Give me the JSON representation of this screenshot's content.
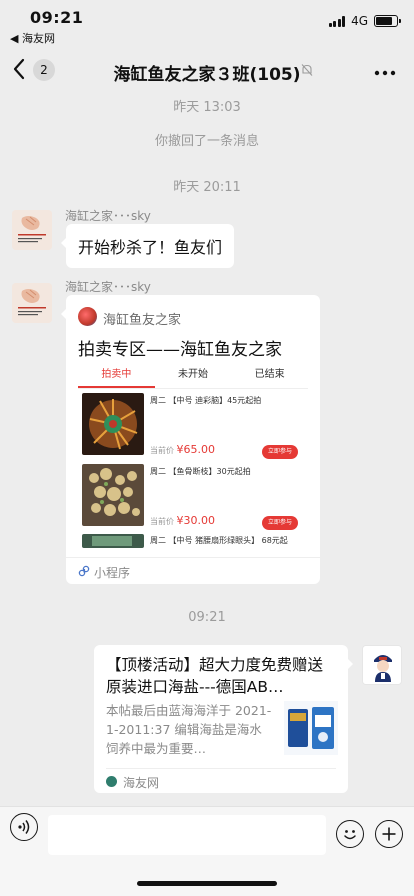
{
  "status_bar": {
    "time": "09:21",
    "back_app": "◀ 海友网",
    "network": "4G",
    "battery_level": 0.8
  },
  "nav": {
    "back_icon": "chevron-left-icon",
    "unread_count": "2",
    "title": "海缸鱼友之家３班(105)",
    "muted": true,
    "more_icon": "more-dots-icon"
  },
  "messages": {
    "time1": "昨天 13:03",
    "recall_notice": "你撤回了一条消息",
    "time2": "昨天 20:11",
    "sender_name": "海缸之家･･･sky",
    "avatar_text": "WE ONLY IN CHARGE OF YOUR HAPPINESS",
    "text_message": "开始秒杀了！鱼友们",
    "sender_name_2": "海缸之家･･･sky",
    "mini_program": {
      "app_name": "海缸鱼友之家",
      "title": "拍卖专区——海缸鱼友之家",
      "tabs": [
        "拍卖中",
        "未开始",
        "已结束"
      ],
      "active_tab": "拍卖中",
      "lots": [
        {
          "desc": "周二 【中号 迪彩脑】45元起拍",
          "price_label": "当前价",
          "price": "¥65.00",
          "button": "立即参与"
        },
        {
          "desc": "周二 【鱼骨断枝】30元起拍",
          "price_label": "当前价",
          "price": "¥30.00",
          "button": "立即参与"
        },
        {
          "desc": "周二 【中号 猪腰扇形绿眼头】 68元起",
          "price_label": "",
          "price": "",
          "button": ""
        }
      ],
      "footer_label": "小程序"
    },
    "time3": "09:21",
    "link_card": {
      "title": "【顶楼活动】超大力度免费赠送原装进口海盐---德国AB…",
      "description": "本帖最后由蓝海海洋于 2021-1-2011:37 编辑海盐是海水饲养中最为重要…",
      "source": "海友网"
    }
  },
  "input_bar": {
    "voice_icon": "voice-icon",
    "emoji_icon": "emoji-icon",
    "plus_icon": "plus-icon",
    "placeholder": ""
  }
}
